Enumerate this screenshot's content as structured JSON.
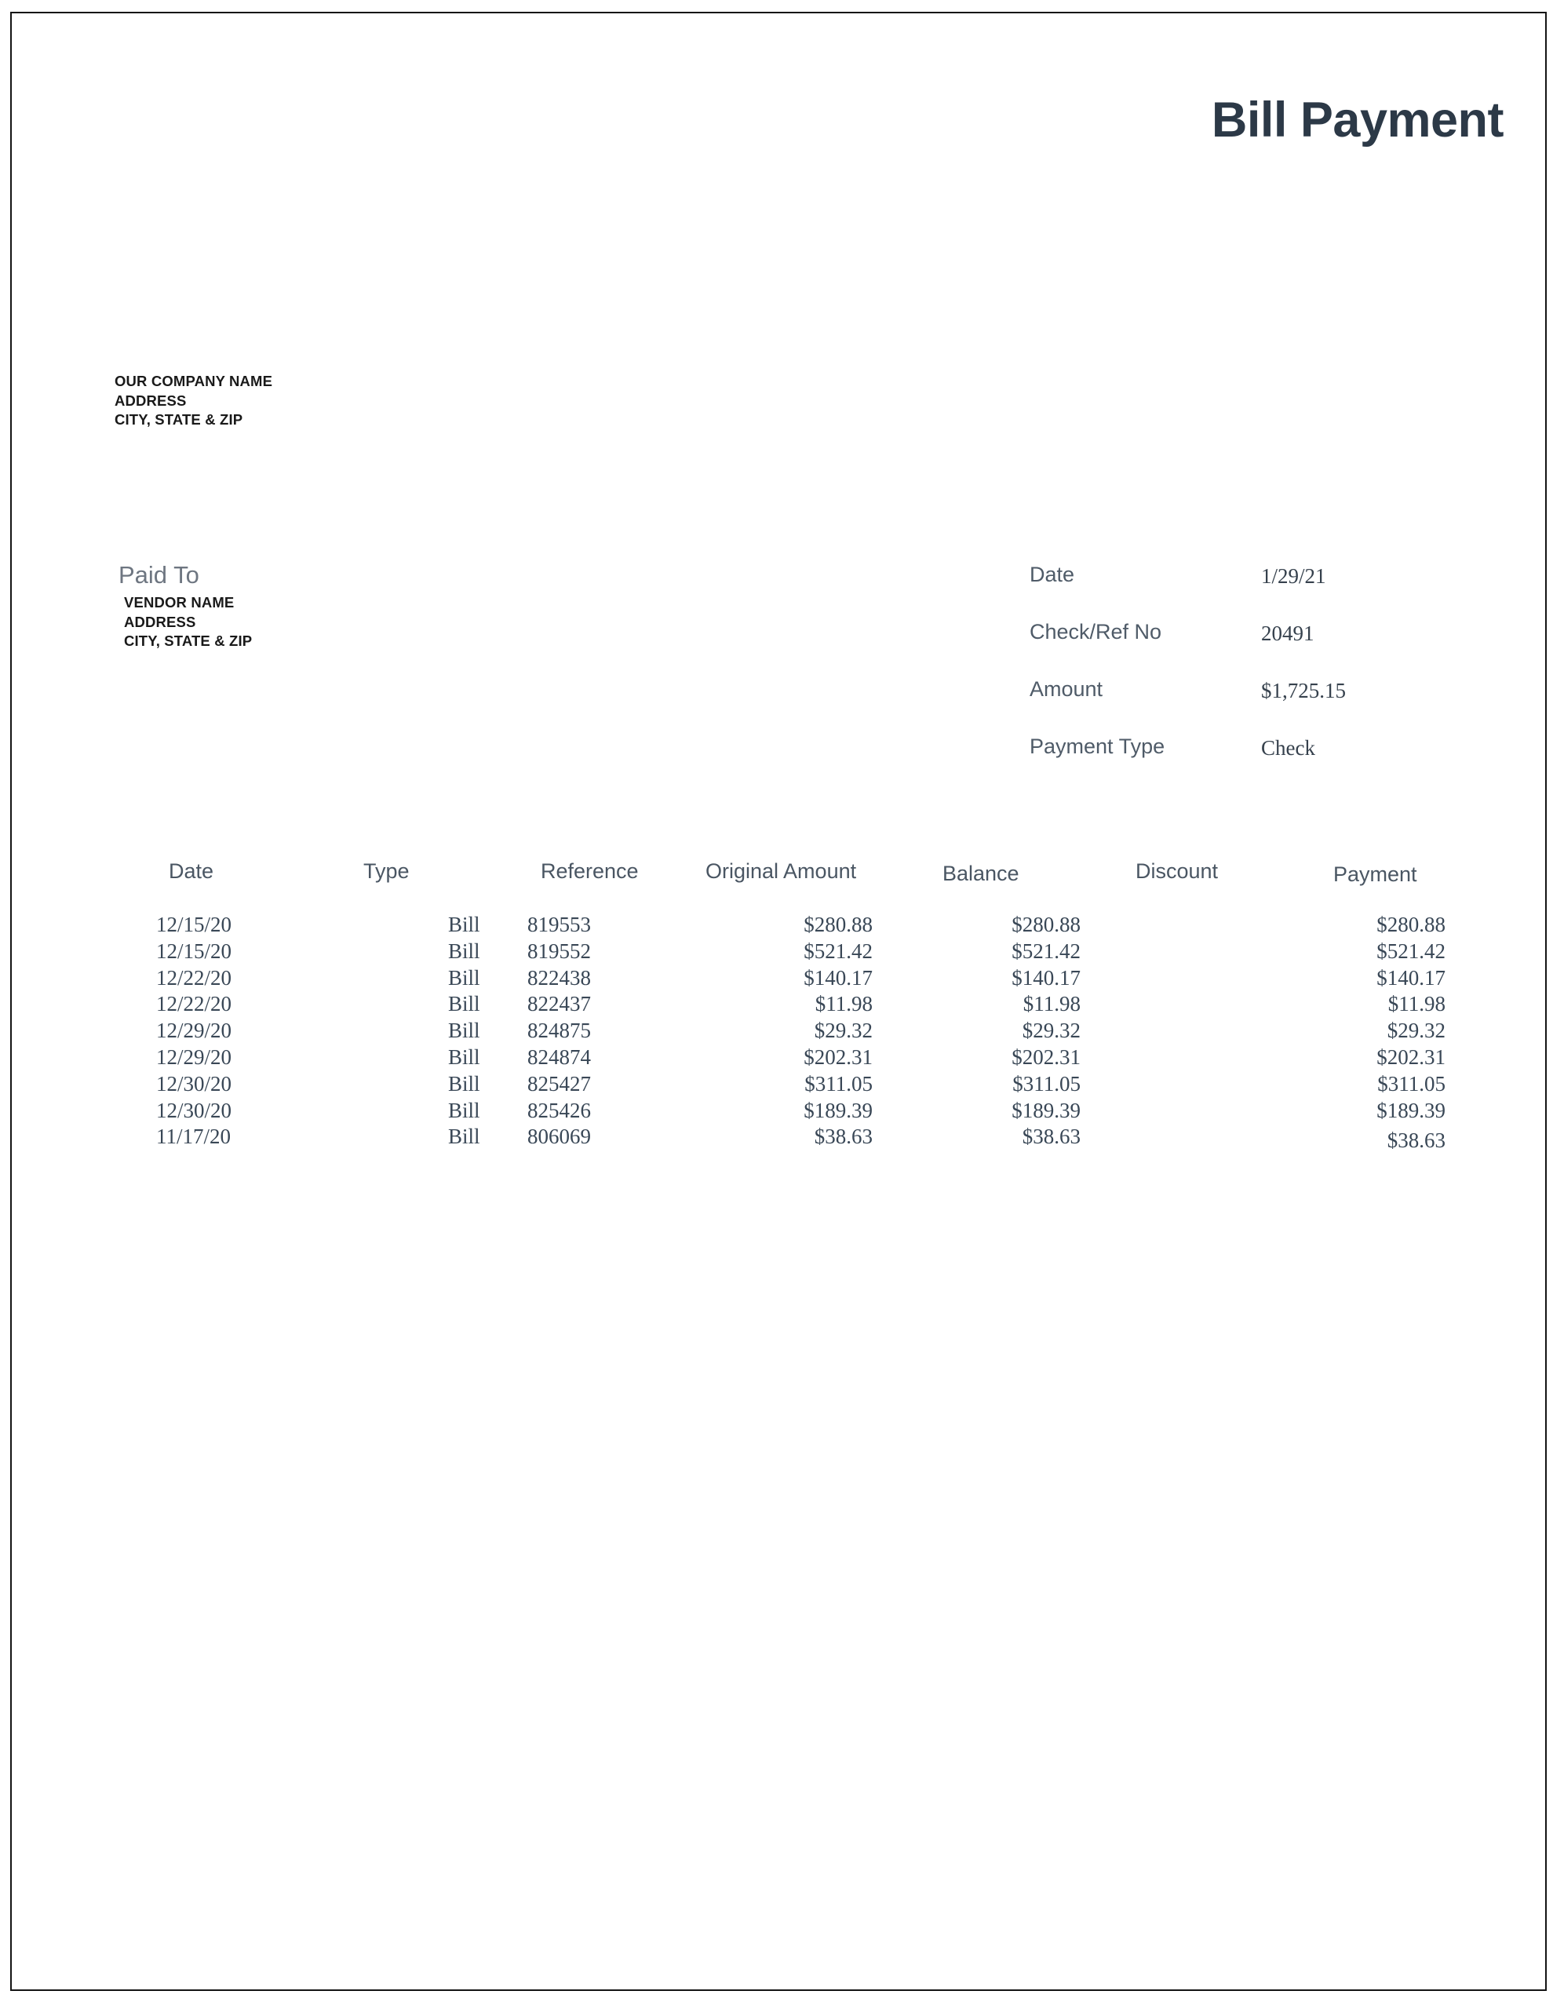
{
  "document": {
    "title": "Bill Payment"
  },
  "company": {
    "lines": [
      "OUR COMPANY NAME",
      "ADDRESS",
      "CITY, STATE & ZIP"
    ]
  },
  "paid_to": {
    "heading": "Paid To",
    "lines": [
      "VENDOR NAME",
      "ADDRESS",
      "CITY, STATE & ZIP"
    ]
  },
  "payment_meta": [
    {
      "label": "Date",
      "value": "1/29/21"
    },
    {
      "label": "Check/Ref No",
      "value": "20491"
    },
    {
      "label": "Amount",
      "value": "$1,725.15"
    },
    {
      "label": "Payment Type",
      "value": "Check"
    }
  ],
  "table": {
    "headers": {
      "date": "Date",
      "type": "Type",
      "reference": "Reference",
      "original_amount": "Original Amount",
      "balance": "Balance",
      "discount": "Discount",
      "payment": "Payment"
    },
    "rows": [
      {
        "date": "12/15/20",
        "type": "Bill",
        "reference": "819553",
        "original_amount": "$280.88",
        "balance": "$280.88",
        "discount": "",
        "payment": "$280.88"
      },
      {
        "date": "12/15/20",
        "type": "Bill",
        "reference": "819552",
        "original_amount": "$521.42",
        "balance": "$521.42",
        "discount": "",
        "payment": "$521.42"
      },
      {
        "date": "12/22/20",
        "type": "Bill",
        "reference": "822438",
        "original_amount": "$140.17",
        "balance": "$140.17",
        "discount": "",
        "payment": "$140.17"
      },
      {
        "date": "12/22/20",
        "type": "Bill",
        "reference": "822437",
        "original_amount": "$11.98",
        "balance": "$11.98",
        "discount": "",
        "payment": "$11.98"
      },
      {
        "date": "12/29/20",
        "type": "Bill",
        "reference": "824875",
        "original_amount": "$29.32",
        "balance": "$29.32",
        "discount": "",
        "payment": "$29.32"
      },
      {
        "date": "12/29/20",
        "type": "Bill",
        "reference": "824874",
        "original_amount": "$202.31",
        "balance": "$202.31",
        "discount": "",
        "payment": "$202.31"
      },
      {
        "date": "12/30/20",
        "type": "Bill",
        "reference": "825427",
        "original_amount": "$311.05",
        "balance": "$311.05",
        "discount": "",
        "payment": "$311.05"
      },
      {
        "date": "12/30/20",
        "type": "Bill",
        "reference": "825426",
        "original_amount": "$189.39",
        "balance": "$189.39",
        "discount": "",
        "payment": "$189.39"
      },
      {
        "date": "11/17/20",
        "type": "Bill",
        "reference": "806069",
        "original_amount": "$38.63",
        "balance": "$38.63",
        "discount": "",
        "payment": "$38.63"
      }
    ]
  },
  "colors": {
    "title": "#2c3947",
    "label": "#4f5b68",
    "value": "#36414d",
    "body_text": "#394756",
    "strong_text": "#191919",
    "page_border": "#141414"
  }
}
